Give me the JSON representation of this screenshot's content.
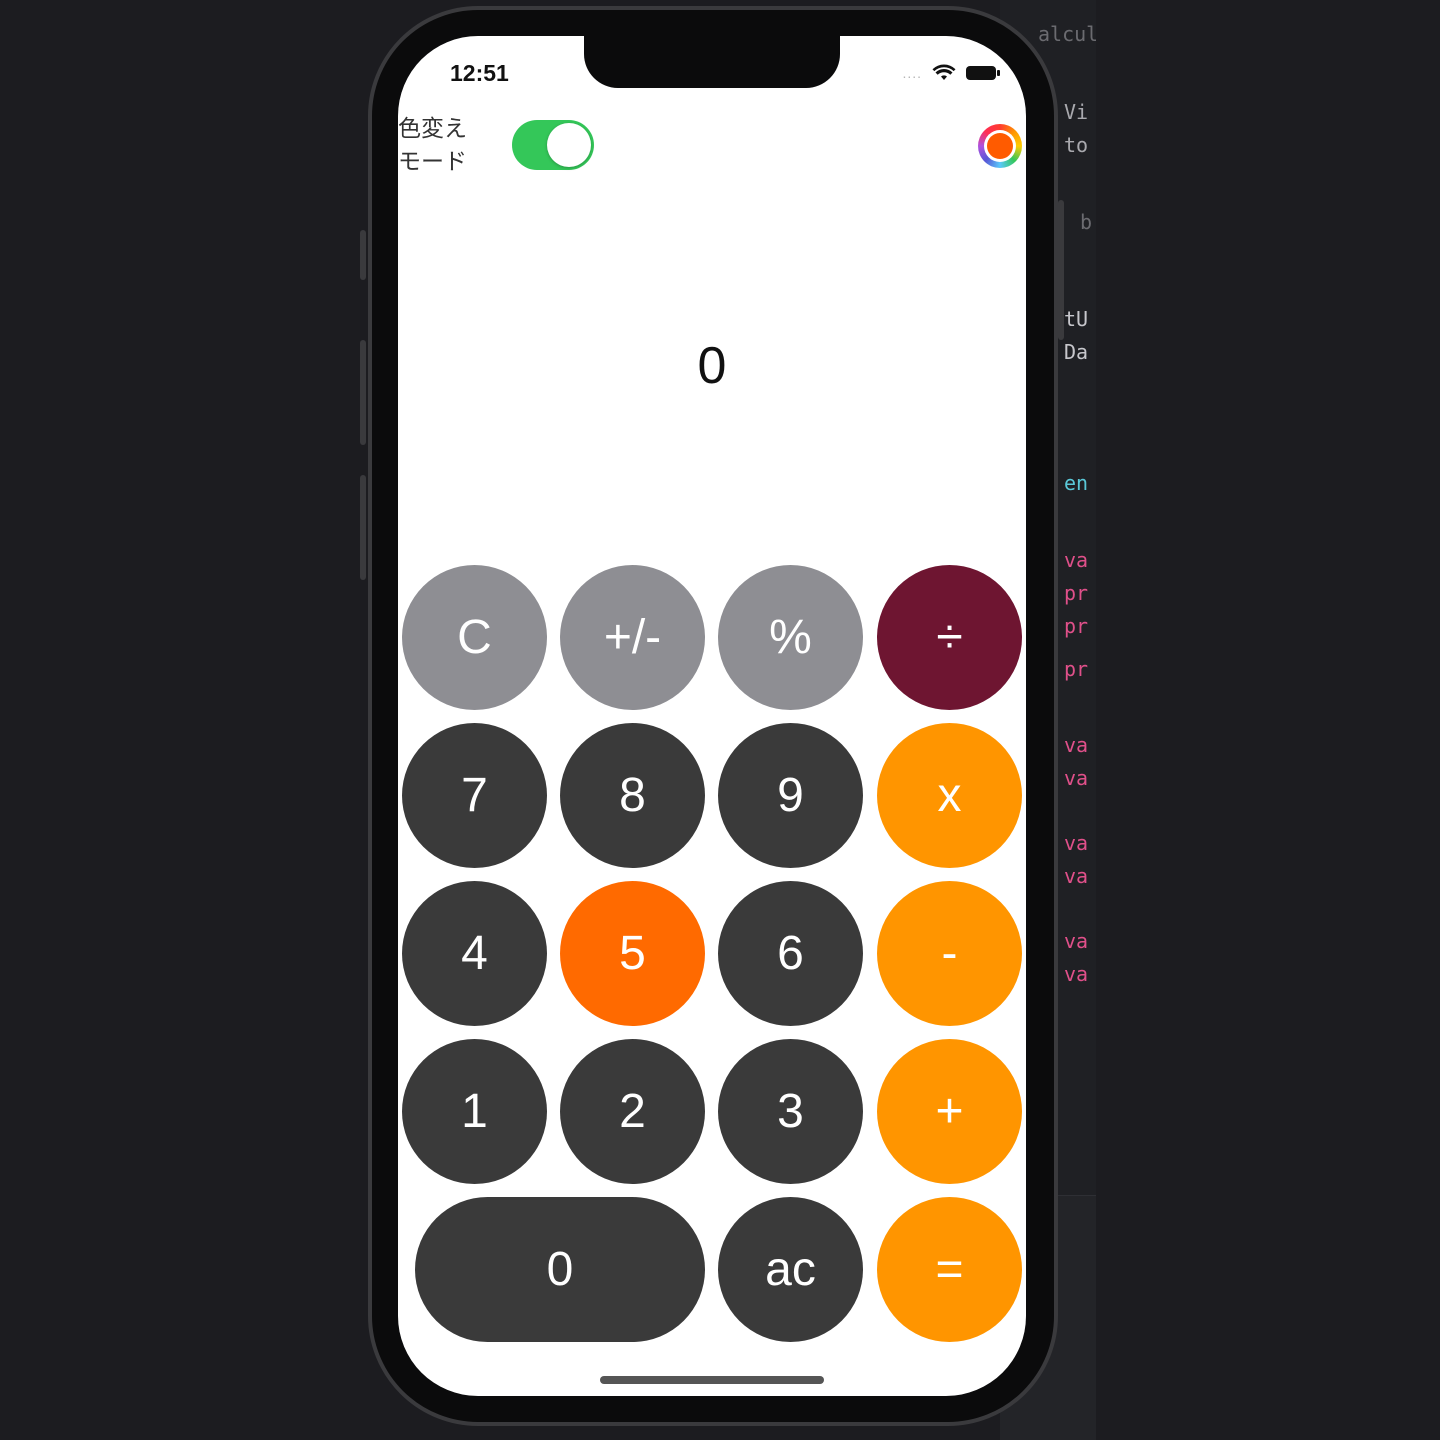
{
  "status_bar": {
    "time": "12:51",
    "signal": "....",
    "icons": [
      "signal-dots-icon",
      "wifi-icon",
      "battery-icon"
    ]
  },
  "header": {
    "mode_label_line1": "色変え",
    "mode_label_line2": "モード",
    "toggle_on": true,
    "color_picker_selected": "#ff5b00"
  },
  "display": {
    "value": "0"
  },
  "keypad": {
    "rows": [
      [
        {
          "label": "C",
          "style": "gray"
        },
        {
          "label": "+/-",
          "style": "gray"
        },
        {
          "label": "%",
          "style": "gray"
        },
        {
          "label": "÷",
          "style": "maroon"
        }
      ],
      [
        {
          "label": "7",
          "style": "dark"
        },
        {
          "label": "8",
          "style": "dark"
        },
        {
          "label": "9",
          "style": "dark"
        },
        {
          "label": "x",
          "style": "orange"
        }
      ],
      [
        {
          "label": "4",
          "style": "dark"
        },
        {
          "label": "5",
          "style": "orange-hi"
        },
        {
          "label": "6",
          "style": "dark"
        },
        {
          "label": "-",
          "style": "orange"
        }
      ],
      [
        {
          "label": "1",
          "style": "dark"
        },
        {
          "label": "2",
          "style": "dark"
        },
        {
          "label": "3",
          "style": "dark"
        },
        {
          "label": "+",
          "style": "orange"
        }
      ],
      [
        {
          "label": "0",
          "style": "dark",
          "wide": true
        },
        {
          "label": "ac",
          "style": "dark"
        },
        {
          "label": "=",
          "style": "orange"
        }
      ]
    ]
  },
  "background_code": {
    "lines": [
      {
        "text": "alcula",
        "color": "#6b6b70"
      },
      {
        "text": "Vi",
        "color": "#a9a9ae"
      },
      {
        "text": "to",
        "color": "#a9a9ae"
      },
      {
        "text": "b",
        "color": "#6b6b70"
      },
      {
        "text": "tU",
        "color": "#c7c7cc"
      },
      {
        "text": "Da",
        "color": "#c7c7cc"
      },
      {
        "text": "en",
        "color": "#5ac8d8"
      },
      {
        "text": "va",
        "color": "#e0508a"
      },
      {
        "text": "pr",
        "color": "#e0508a"
      },
      {
        "text": "pr",
        "color": "#e0508a"
      },
      {
        "text": "pr",
        "color": "#e0508a"
      },
      {
        "text": "va",
        "color": "#e0508a"
      },
      {
        "text": "va",
        "color": "#e0508a"
      },
      {
        "text": "va",
        "color": "#e0508a"
      },
      {
        "text": "va",
        "color": "#e0508a"
      },
      {
        "text": "va",
        "color": "#e0508a"
      },
      {
        "text": "va",
        "color": "#e0508a"
      }
    ]
  },
  "colors": {
    "toggle_on": "#34c759",
    "function_key": "#8e8e93",
    "digit_key": "#3a3a3a",
    "operator_key": "#ff9500",
    "highlight_key": "#ff6a00",
    "divide_key": "#6e1531"
  }
}
